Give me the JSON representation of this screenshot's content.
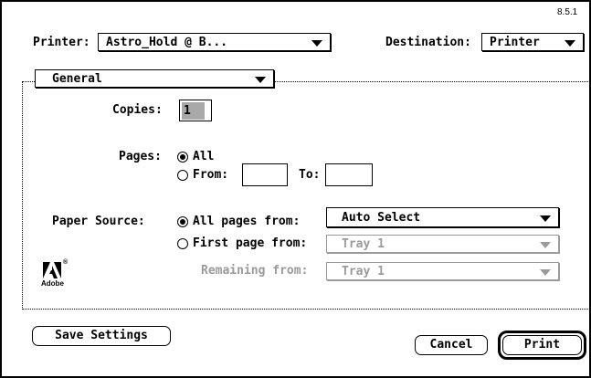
{
  "version": "8.5.1",
  "printer": {
    "label": "Printer:",
    "value": "Astro_Hold @ B..."
  },
  "destination": {
    "label": "Destination:",
    "value": "Printer"
  },
  "panel": {
    "value": "General"
  },
  "copies": {
    "label": "Copies:",
    "value": "1"
  },
  "pages": {
    "label": "Pages:",
    "all_label": "All",
    "from_label": "From:",
    "to_label": "To:",
    "from_value": "",
    "to_value": "",
    "selected": "all"
  },
  "paper_source": {
    "label": "Paper Source:",
    "all_pages_label": "All pages from:",
    "all_pages_value": "Auto Select",
    "first_page_label": "First page from:",
    "first_page_value": "Tray 1",
    "remaining_label": "Remaining from:",
    "remaining_value": "Tray 1",
    "selected": "all_pages"
  },
  "logo": {
    "name": "Adobe",
    "registered": "®"
  },
  "buttons": {
    "save_settings": "Save Settings",
    "cancel": "Cancel",
    "print": "Print"
  },
  "colors": {
    "disabled": "#9a9a9a",
    "selection": "#a8a8a8"
  }
}
